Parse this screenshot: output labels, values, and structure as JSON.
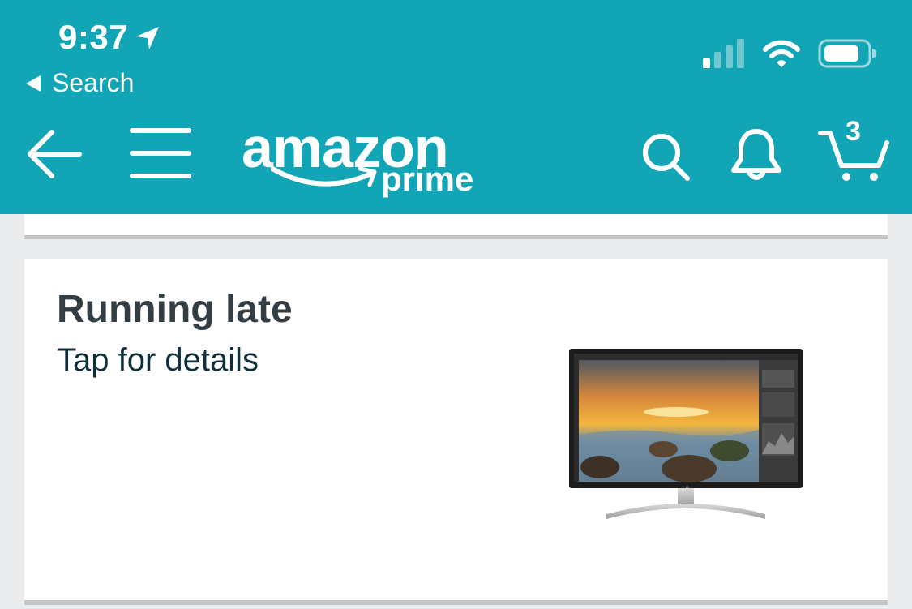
{
  "status_bar": {
    "time": "9:37",
    "back_label": "Search"
  },
  "nav": {
    "logo_text": "amazon",
    "logo_subtext": "prime",
    "cart_count": "3",
    "brand_color": "#12a5b5"
  },
  "card": {
    "title": "Running late",
    "subtitle": "Tap for details",
    "monitor_brand": "LG"
  },
  "icons": [
    "location-arrow-icon",
    "back-triangle-icon",
    "signal-icon",
    "wifi-icon",
    "battery-icon",
    "back-arrow-icon",
    "menu-icon",
    "search-icon",
    "bell-icon",
    "cart-icon"
  ]
}
